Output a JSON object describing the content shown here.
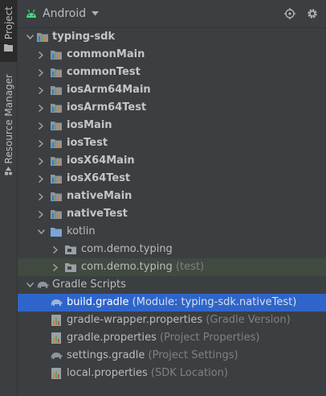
{
  "sidebar": {
    "project_tab": "Project",
    "resource_tab": "Resource Manager"
  },
  "header": {
    "view_mode": "Android",
    "icons": [
      "android-icon",
      "chevron-down-icon",
      "locate-icon",
      "gear-icon"
    ]
  },
  "tree": {
    "root": "typing-sdk",
    "source_sets": [
      "commonMain",
      "commonTest",
      "iosArm64Main",
      "iosArm64Test",
      "iosMain",
      "iosTest",
      "iosX64Main",
      "iosX64Test",
      "nativeMain",
      "nativeTest"
    ],
    "kotlin_folder": "kotlin",
    "packages": [
      {
        "name": "com.demo.typing",
        "hint": ""
      },
      {
        "name": "com.demo.typing",
        "hint": "(test)"
      }
    ],
    "gradle_scripts": "Gradle Scripts",
    "gradle_files": [
      {
        "name": "build.gradle",
        "hint": "(Module: typing-sdk.nativeTest)",
        "icon": "gradle-elephant-icon",
        "selected": true
      },
      {
        "name": "gradle-wrapper.properties",
        "hint": "(Gradle Version)",
        "icon": "properties-file-icon",
        "selected": false
      },
      {
        "name": "gradle.properties",
        "hint": "(Project Properties)",
        "icon": "properties-file-icon",
        "selected": false
      },
      {
        "name": "settings.gradle",
        "hint": "(Project Settings)",
        "icon": "gradle-elephant-icon",
        "selected": false
      },
      {
        "name": "local.properties",
        "hint": "(SDK Location)",
        "icon": "properties-file-icon",
        "selected": false
      }
    ]
  },
  "colors": {
    "background": "#3c3f41",
    "selection": "#2f65ca",
    "highlight": "#414a40",
    "hint_text": "#808080",
    "folder_blue": "#7aa6d6"
  }
}
